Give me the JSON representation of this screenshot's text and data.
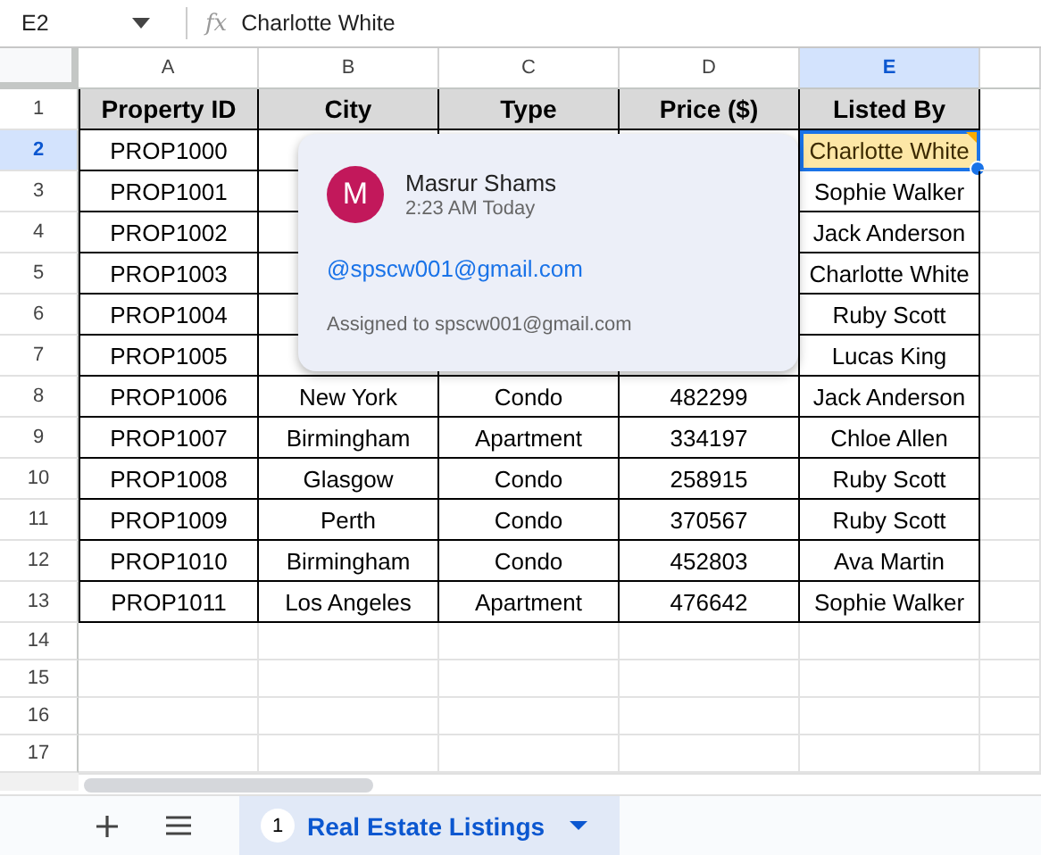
{
  "formula_bar": {
    "cell_ref": "E2",
    "formula_label": "fx",
    "value": "Charlotte White"
  },
  "columns": [
    {
      "label": "A",
      "selected": false
    },
    {
      "label": "B",
      "selected": false
    },
    {
      "label": "C",
      "selected": false
    },
    {
      "label": "D",
      "selected": false
    },
    {
      "label": "E",
      "selected": true
    }
  ],
  "rows": [
    {
      "number": "1",
      "selected": false,
      "header": true,
      "column_a": "Property ID",
      "column_b": "City",
      "column_c": "Type",
      "column_d": "Price ($)",
      "column_e": "Listed By"
    },
    {
      "number": "2",
      "selected": true,
      "column_a": "PROP1000",
      "column_e": {
        "text": "Charlotte White",
        "selected": true,
        "has_comment": true
      }
    },
    {
      "number": "3",
      "selected": false,
      "column_a": "PROP1001",
      "column_e": "Sophie Walker"
    },
    {
      "number": "4",
      "selected": false,
      "column_a": "PROP1002",
      "column_e": "Jack Anderson"
    },
    {
      "number": "5",
      "selected": false,
      "column_a": "PROP1003",
      "column_e": "Charlotte White"
    },
    {
      "number": "6",
      "selected": false,
      "column_a": "PROP1004",
      "column_e": "Ruby Scott"
    },
    {
      "number": "7",
      "selected": false,
      "column_a": "PROP1005",
      "column_e": "Lucas King"
    },
    {
      "number": "8",
      "selected": false,
      "column_a": "PROP1006",
      "column_b": "New York",
      "column_c": "Condo",
      "column_d": "482299",
      "column_e": "Jack Anderson"
    },
    {
      "number": "9",
      "selected": false,
      "column_a": "PROP1007",
      "column_b": "Birmingham",
      "column_c": "Apartment",
      "column_d": "334197",
      "column_e": "Chloe Allen"
    },
    {
      "number": "10",
      "selected": false,
      "column_a": "PROP1008",
      "column_b": "Glasgow",
      "column_c": "Condo",
      "column_d": "258915",
      "column_e": "Ruby Scott"
    },
    {
      "number": "11",
      "selected": false,
      "column_a": "PROP1009",
      "column_b": "Perth",
      "column_c": "Condo",
      "column_d": "370567",
      "column_e": "Ruby Scott"
    },
    {
      "number": "12",
      "selected": false,
      "column_a": "PROP1010",
      "column_b": "Birmingham",
      "column_c": "Condo",
      "column_d": "452803",
      "column_e": "Ava Martin"
    },
    {
      "number": "13",
      "selected": false,
      "column_a": "PROP1011",
      "column_b": "Los Angeles",
      "column_c": "Apartment",
      "column_d": "476642",
      "column_e": "Sophie Walker"
    },
    {
      "number": "14",
      "selected": false
    },
    {
      "number": "15",
      "selected": false
    },
    {
      "number": "16",
      "selected": false
    },
    {
      "number": "17",
      "selected": false
    }
  ],
  "comment": {
    "avatar_letter": "M",
    "author": "Masrur Shams",
    "time": "2:23 AM Today",
    "mention": "@spscw001@gmail.com",
    "assigned": "Assigned to spscw001@gmail.com"
  },
  "sheet_tabs": [
    {
      "badge": "1",
      "label": "Real Estate Listings",
      "selected": true
    }
  ]
}
